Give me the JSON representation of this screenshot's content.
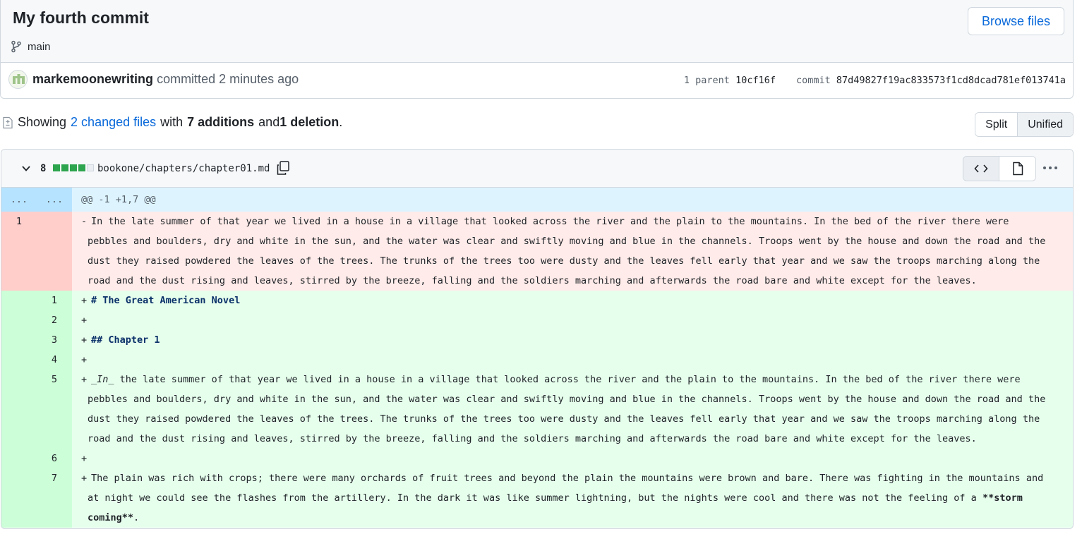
{
  "commit": {
    "title": "My fourth commit",
    "branch": "main",
    "browse_label": "Browse files",
    "author": "markemoonewriting",
    "action": "committed",
    "time": "2 minutes ago",
    "parent_label": "1 parent",
    "parent_sha": "10cf16f",
    "commit_label": "commit",
    "commit_sha": "87d49827f19ac833573f1cd8dcad781ef013741a"
  },
  "summary": {
    "prefix": "Showing",
    "changed_files": "2 changed files",
    "with": "with",
    "additions": "7 additions",
    "and": "and",
    "deletions": "1 deletion",
    "period": ".",
    "split_label": "Split",
    "unified_label": "Unified",
    "active_view": "Unified"
  },
  "file": {
    "change_count": "8",
    "diffstat": [
      "green",
      "green",
      "green",
      "green",
      "gray"
    ],
    "path": "bookone/chapters/chapter01.md"
  },
  "diff": {
    "hunk": {
      "left": "...",
      "right": "...",
      "header": "@@ -1 +1,7 @@"
    },
    "deleted": {
      "old_no": "1",
      "marker": "-",
      "lines": [
        "In the late summer of that year we lived in a house in a village that looked across the river and the plain to the mountains. In the bed of the river there were",
        "pebbles and boulders, dry and white in the sun, and the water was clear and swiftly moving and blue in the channels. Troops went by the house and down the road and the",
        "dust they raised powdered the leaves of the trees. The trunks of the trees too were dusty and the leaves fell early that year and we saw the troops marching along the",
        "road and the dust rising and leaves, stirred by the breeze, falling and the soldiers marching and afterwards the road bare and white except for the leaves."
      ]
    },
    "added": [
      {
        "no": "1",
        "marker": "+",
        "text": "# The Great American Novel"
      },
      {
        "no": "2",
        "marker": "+",
        "text": ""
      },
      {
        "no": "3",
        "marker": "+",
        "text": "## Chapter 1"
      },
      {
        "no": "4",
        "marker": "+",
        "text": ""
      },
      {
        "no": "5",
        "marker": "+",
        "em": "_In_",
        "first": " the late summer of that year we lived in a house in a village that looked across the river and the plain to the mountains. In the bed of the river there were",
        "lines": [
          "pebbles and boulders, dry and white in the sun, and the water was clear and swiftly moving and blue in the channels. Troops went by the house and down the road and the",
          "dust they raised powdered the leaves of the trees. The trunks of the trees too were dusty and the leaves fell early that year and we saw the troops marching along the",
          "road and the dust rising and leaves, stirred by the breeze, falling and the soldiers marching and afterwards the road bare and white except for the leaves."
        ]
      },
      {
        "no": "6",
        "marker": "+",
        "text": ""
      },
      {
        "no": "7",
        "marker": "+",
        "first": "The plain was rich with crops; there were many orchards of fruit trees and beyond the plain the mountains were brown and bare. There was fighting in the mountains and",
        "second": "at night we could see the flashes from the artillery. In the dark it was like summer lightning, but the nights were cool and there was not the feeling of a",
        "strong_a": "**storm",
        "strong_b": "coming**",
        "tail": "."
      }
    ]
  },
  "colors": {
    "link": "#0969da",
    "diffstat_green": "#2da44e",
    "diffstat_gray": "#eaeef2"
  },
  "icons": [
    "git-branch-icon",
    "avatar-identicon",
    "file-diff-icon",
    "chevron-down-icon",
    "copy-icon",
    "code-icon",
    "file-icon",
    "kebab-horizontal-icon"
  ]
}
